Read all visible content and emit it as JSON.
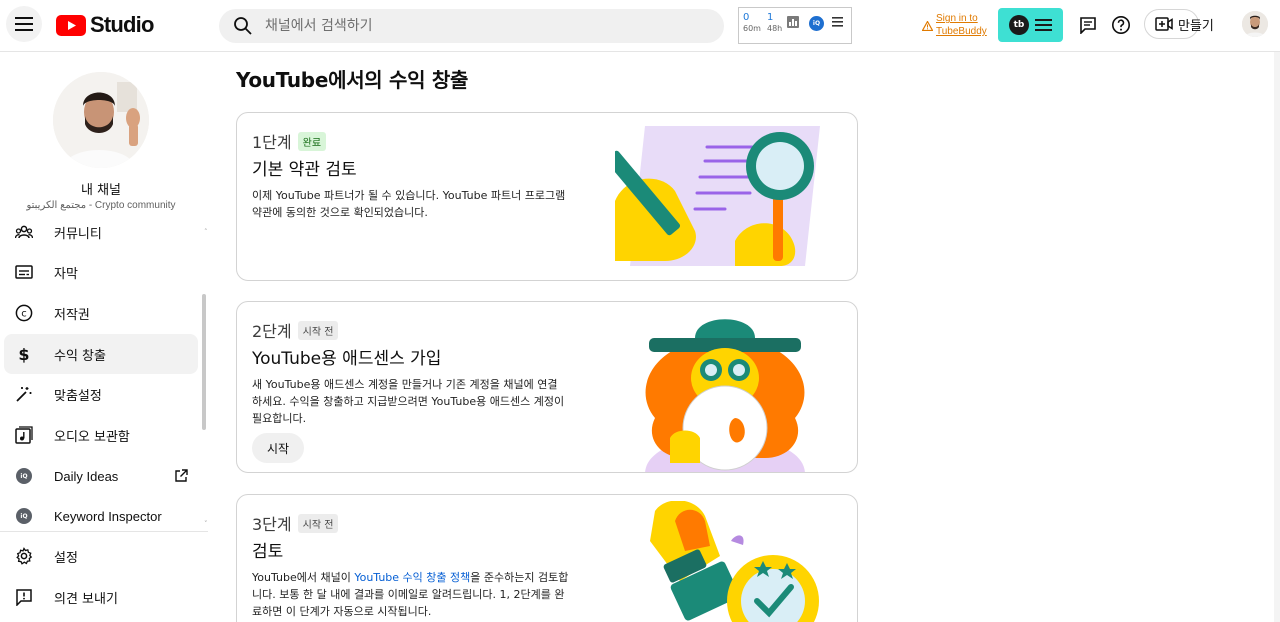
{
  "header": {
    "logo_text": "Studio",
    "search_placeholder": "채널에서 검색하기",
    "stats": [
      {
        "value": "0",
        "label": "60m"
      },
      {
        "value": "1",
        "label": "48h"
      }
    ],
    "stats_badge": "iQ",
    "tubebuddy_signin_line1": "Sign in to",
    "tubebuddy_signin_line2": "TubeBuddy",
    "tubebuddy_logo": "tb",
    "create_label": "만들기"
  },
  "sidebar": {
    "channel_title": "내 채널",
    "channel_name": "مجتمع الكريبتو - Crypto community",
    "items": [
      {
        "label": "커뮤니티",
        "icon": "community-icon"
      },
      {
        "label": "자막",
        "icon": "subtitles-icon"
      },
      {
        "label": "저작권",
        "icon": "copyright-icon"
      },
      {
        "label": "수익 창출",
        "icon": "dollar-icon",
        "active": true
      },
      {
        "label": "맞춤설정",
        "icon": "magic-wand-icon"
      },
      {
        "label": "오디오 보관함",
        "icon": "audio-library-icon"
      },
      {
        "label": "Daily Ideas",
        "icon": "vidiq-icon",
        "badge": "iQ"
      },
      {
        "label": "Keyword Inspector",
        "icon": "vidiq-icon",
        "badge": "iQ"
      },
      {
        "label": "설정",
        "icon": "settings-icon"
      },
      {
        "label": "의견 보내기",
        "icon": "feedback-icon"
      }
    ]
  },
  "main": {
    "title": "YouTube에서의 수익 창출",
    "steps": [
      {
        "step": "1단계",
        "badge": "완료",
        "title": "기본 약관 검토",
        "desc_lines": [
          "이제 YouTube 파트너가 될 수 있습니다. YouTube 파트너 프로그램",
          "약관에 동의한 것으로 확인되었습니다."
        ]
      },
      {
        "step": "2단계",
        "badge": "시작 전",
        "title": "YouTube용 애드센스 가입",
        "desc_lines": [
          "새 YouTube용 애드센스 계정을 만들거나 기존 계정을 채널에 연결",
          "하세요. 수익을 창출하고 지급받으려면 YouTube용 애드센스 계정이",
          "필요합니다."
        ],
        "button": "시작"
      },
      {
        "step": "3단계",
        "badge": "시작 전",
        "title": "검토",
        "desc_line1_pre": "YouTube에서 채널이 ",
        "desc_line1_link": "YouTube 수익 창출 정책",
        "desc_line1_post": "을 준수하는지 검토합",
        "desc_lines_rest": [
          "니다. 보통 한 달 내에 결과를 이메일로 알려드립니다. 1, 2단계를 완",
          "료하면 이 단계가 자동으로 시작됩니다."
        ]
      }
    ]
  },
  "colors": {
    "accent_red": "#ff0000",
    "tubebuddy_cyan": "#3ee0d3",
    "link_blue": "#065fd4"
  }
}
